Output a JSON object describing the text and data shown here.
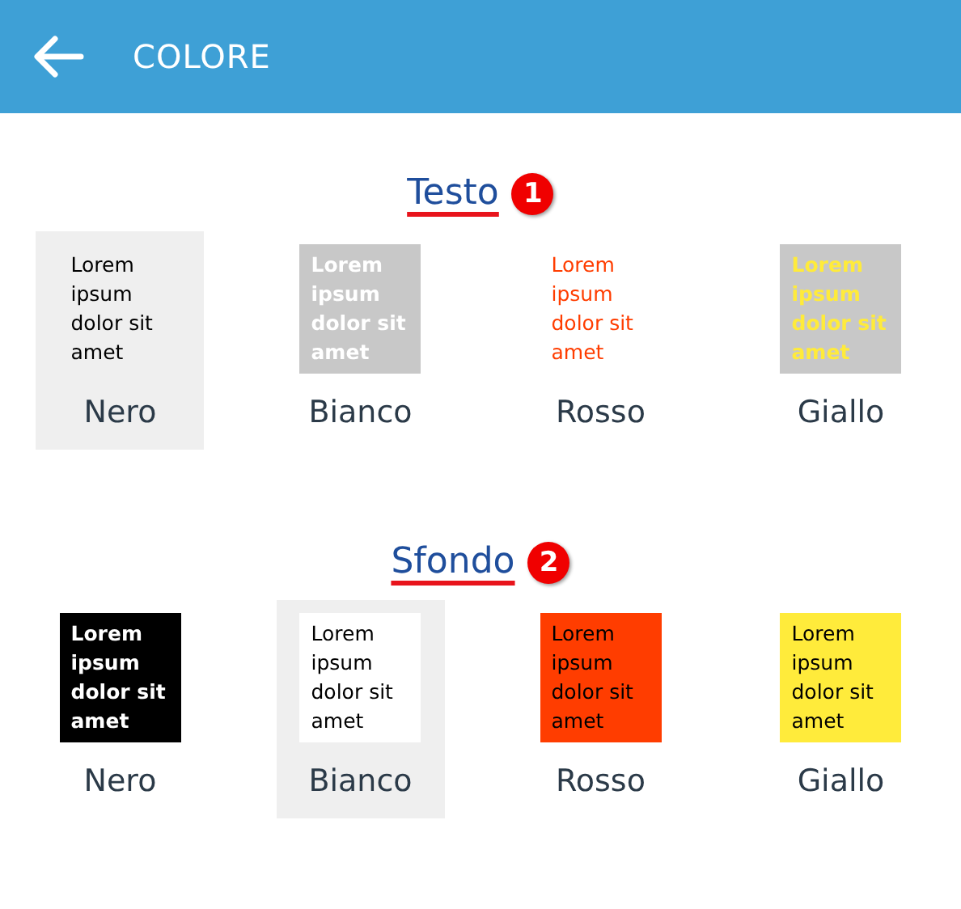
{
  "header": {
    "title": "COLORE"
  },
  "sections": [
    {
      "title": "Testo",
      "badge": "1",
      "kind": "text",
      "options": [
        {
          "label": "Nero",
          "sample": "Lorem ipsum dolor sit amet",
          "color": "#000000",
          "selected": true
        },
        {
          "label": "Bianco",
          "sample": "Lorem ipsum dolor sit amet",
          "color": "#ffffff",
          "selected": false
        },
        {
          "label": "Rosso",
          "sample": "Lorem ipsum dolor sit amet",
          "color": "#ff3d00",
          "selected": false
        },
        {
          "label": "Giallo",
          "sample": "Lorem ipsum dolor sit amet",
          "color": "#ffeb3b",
          "selected": false
        }
      ]
    },
    {
      "title": "Sfondo",
      "badge": "2",
      "kind": "background",
      "options": [
        {
          "label": "Nero",
          "sample": "Lorem ipsum dolor sit amet",
          "color": "#000000",
          "selected": false
        },
        {
          "label": "Bianco",
          "sample": "Lorem ipsum dolor sit amet",
          "color": "#ffffff",
          "selected": true
        },
        {
          "label": "Rosso",
          "sample": "Lorem ipsum dolor sit amet",
          "color": "#ff3d00",
          "selected": false
        },
        {
          "label": "Giallo",
          "sample": "Lorem ipsum dolor sit amet",
          "color": "#ffeb3b",
          "selected": false
        }
      ]
    }
  ]
}
